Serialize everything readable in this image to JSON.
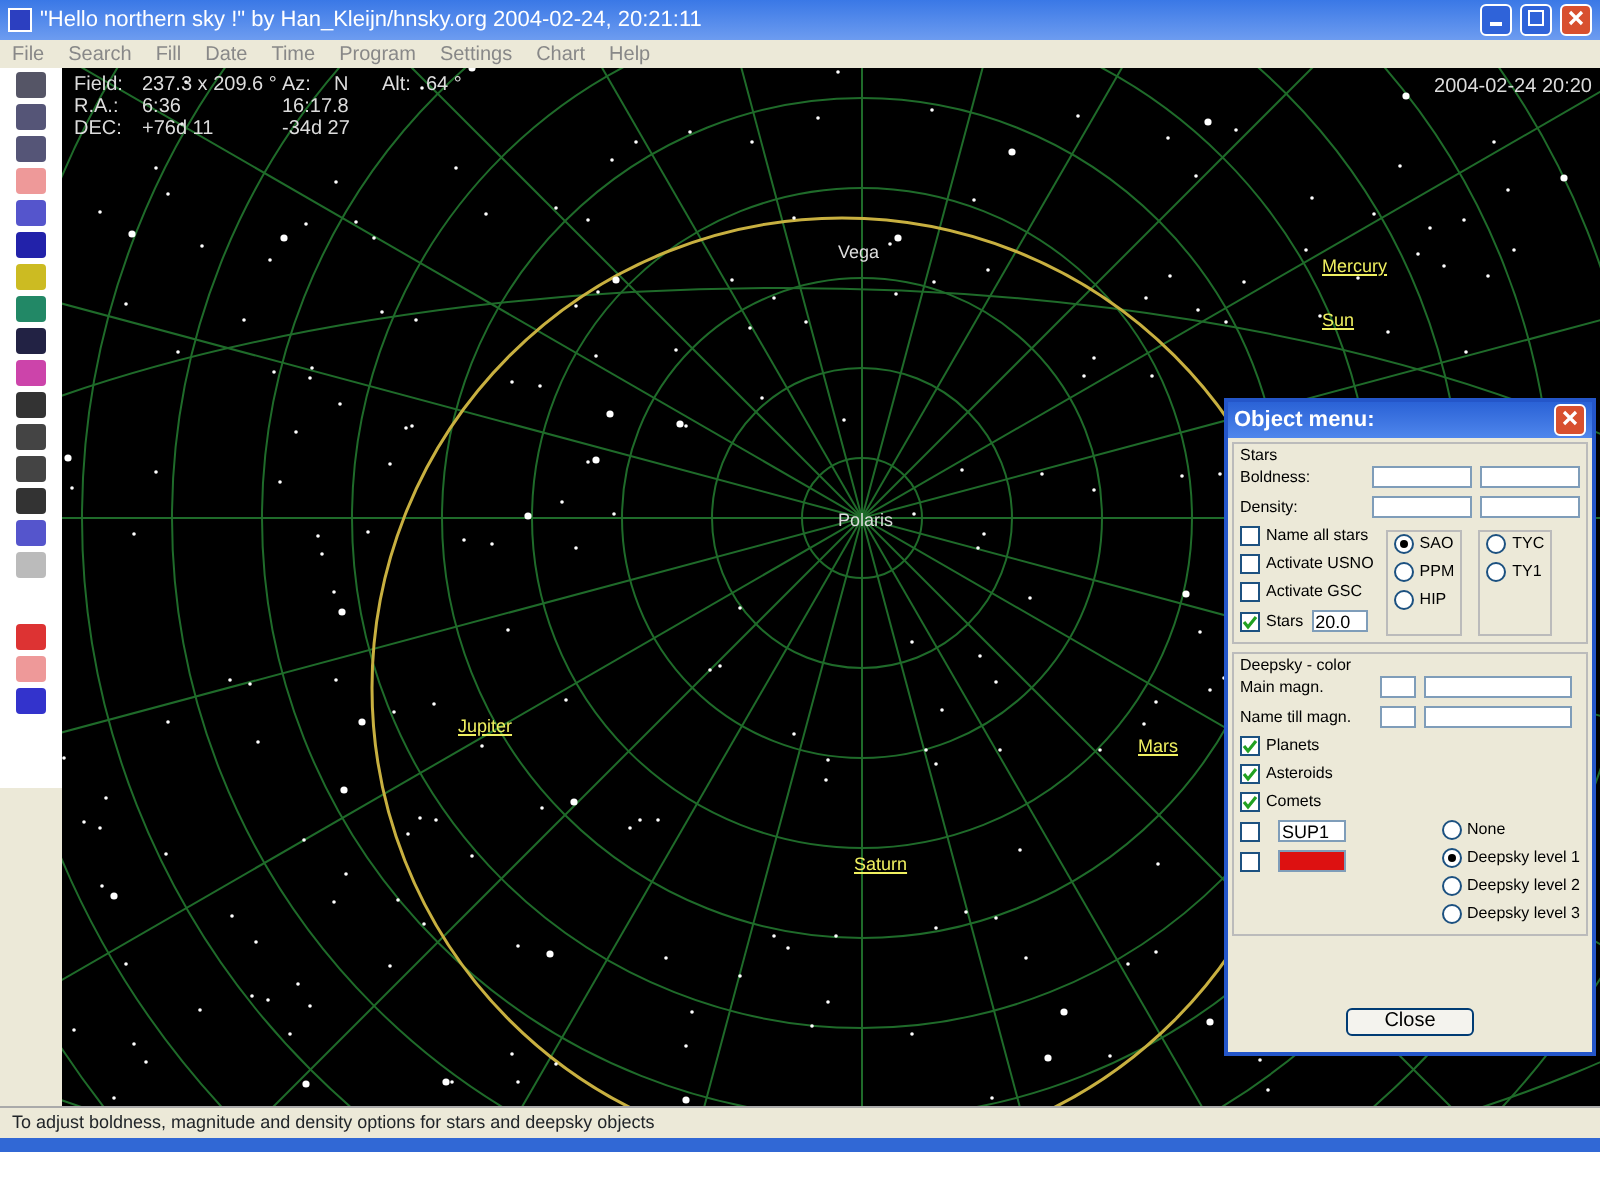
{
  "window": {
    "title": "\"Hello northern sky !\" by Han_Kleijn/hnsky.org    2004-02-24, 20:21:11"
  },
  "menu": [
    "File",
    "Search",
    "Fill",
    "Date",
    "Time",
    "Program",
    "Settings",
    "Chart",
    "Help"
  ],
  "info": [
    [
      "Field:",
      "237.3 x 209.6 °",
      "Az:",
      "N",
      "Alt:",
      "64 °"
    ],
    [
      "R.A.:",
      "6:36",
      "16:17.8"
    ],
    [
      "DEC:",
      "+76d 11",
      "-34d 27"
    ]
  ],
  "datetime": "2004-02-24  20:20",
  "sky_labels": [
    {
      "text": "Vega",
      "kind": "star"
    },
    {
      "text": "Mercury",
      "kind": "planet"
    },
    {
      "text": "Sun",
      "kind": "planet"
    },
    {
      "text": "Polaris",
      "kind": "star"
    },
    {
      "text": "Jupiter",
      "kind": "planet"
    },
    {
      "text": "Mars",
      "kind": "planet"
    },
    {
      "text": "Saturn",
      "kind": "planet"
    }
  ],
  "dialog": {
    "title": "Object menu:",
    "stars_group": "Stars",
    "boldness_label": "Boldness:",
    "density_label": "Density:",
    "checks": [
      {
        "label": "Name all stars",
        "checked": false
      },
      {
        "label": "Activate USNO",
        "checked": false
      },
      {
        "label": "Activate GSC",
        "checked": false
      },
      {
        "label": "Stars",
        "checked": true
      }
    ],
    "stars_magnitude": "20.0",
    "catalogs": [
      {
        "label": "SAO",
        "selected": true
      },
      {
        "label": "PPM",
        "selected": false
      },
      {
        "label": "HIP",
        "selected": false
      }
    ],
    "tycho": [
      {
        "label": "TYC",
        "selected": false
      },
      {
        "label": "TY1",
        "selected": false
      }
    ],
    "deepsky_group": "Deepsky - color",
    "main_magn_label": "Main magn.",
    "name_magn_label": "Name till magn.",
    "objects": [
      {
        "label": "Planets",
        "checked": true
      },
      {
        "label": "Asteroids",
        "checked": true
      },
      {
        "label": "Comets",
        "checked": true
      }
    ],
    "colors": [
      {
        "label": "SUP1",
        "color": "#ffffff",
        "checked": false
      },
      {
        "color": "#dd1111",
        "checked": false
      }
    ],
    "levels": [
      {
        "label": "None",
        "selected": false
      },
      {
        "label": "Deepsky level 1",
        "selected": true
      },
      {
        "label": "Deepsky level 2",
        "selected": false
      },
      {
        "label": "Deepsky level 3",
        "selected": false
      }
    ],
    "close": "Close"
  },
  "status_bar": "To adjust boldness, magnitude and density options for stars and deepsky objects"
}
